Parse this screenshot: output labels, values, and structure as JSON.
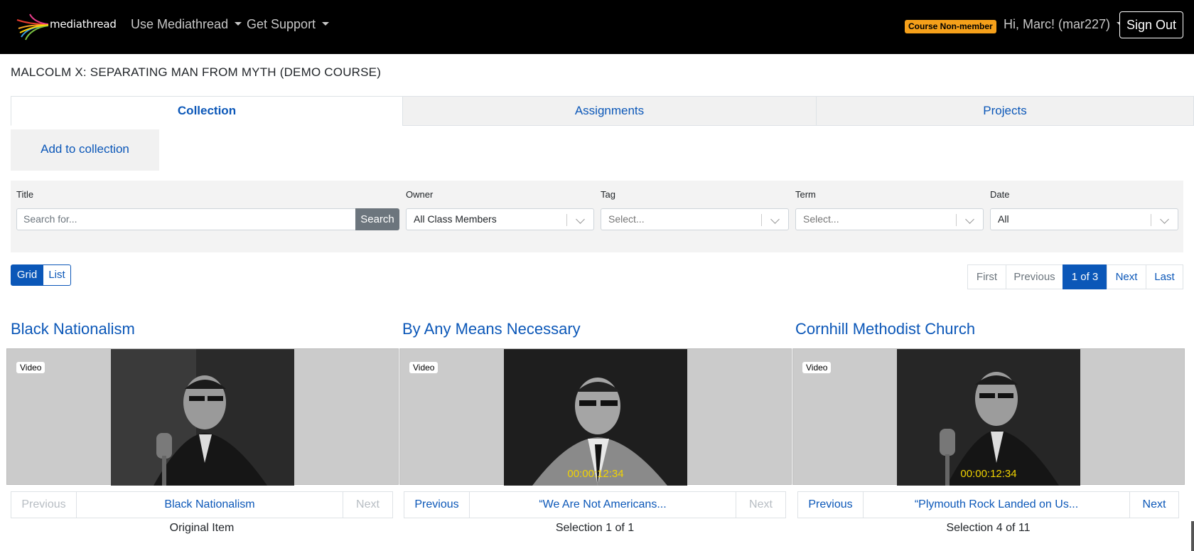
{
  "navbar": {
    "brand": "mediathread",
    "menus": [
      "Use Mediathread",
      "Get Support"
    ],
    "badge": "Course Non-member",
    "user": "Hi, Marc! (mar227)",
    "signout": "Sign Out"
  },
  "course_title": "MALCOLM X: SEPARATING MAN FROM MYTH (DEMO COURSE)",
  "tabs": [
    "Collection",
    "Assignments",
    "Projects"
  ],
  "add_collection": "Add to collection",
  "filters": {
    "title_label": "Title",
    "search_placeholder": "Search for...",
    "search_button": "Search",
    "owner_label": "Owner",
    "owner_value": "All Class Members",
    "tag_label": "Tag",
    "tag_placeholder": "Select...",
    "term_label": "Term",
    "term_placeholder": "Select...",
    "date_label": "Date",
    "date_value": "All"
  },
  "view_toggle": [
    "Grid",
    "List"
  ],
  "pagination": [
    "First",
    "Previous",
    "1 of 3",
    "Next",
    "Last"
  ],
  "cards": [
    {
      "title": "Black Nationalism",
      "badge": "Video",
      "timecode": "",
      "prev": "Previous",
      "label": "Black Nationalism",
      "next": "Next",
      "caption": "Original Item"
    },
    {
      "title": "By Any Means Necessary",
      "badge": "Video",
      "timecode": "00:00:12:34",
      "prev": "Previous",
      "label": "“We Are Not Americans...",
      "next": "Next",
      "caption": "Selection 1 of 1"
    },
    {
      "title": "Cornhill Methodist Church",
      "badge": "Video",
      "timecode": "00:00:12:34",
      "prev": "Previous",
      "label": "“Plymouth Rock Landed on Us...",
      "next": "Next",
      "caption": "Selection 4 of 11"
    }
  ],
  "colors": {
    "navbar": "#000000",
    "accent": "#0b57b8",
    "badge": "#f5a01a",
    "timecode": "#f2d400"
  }
}
